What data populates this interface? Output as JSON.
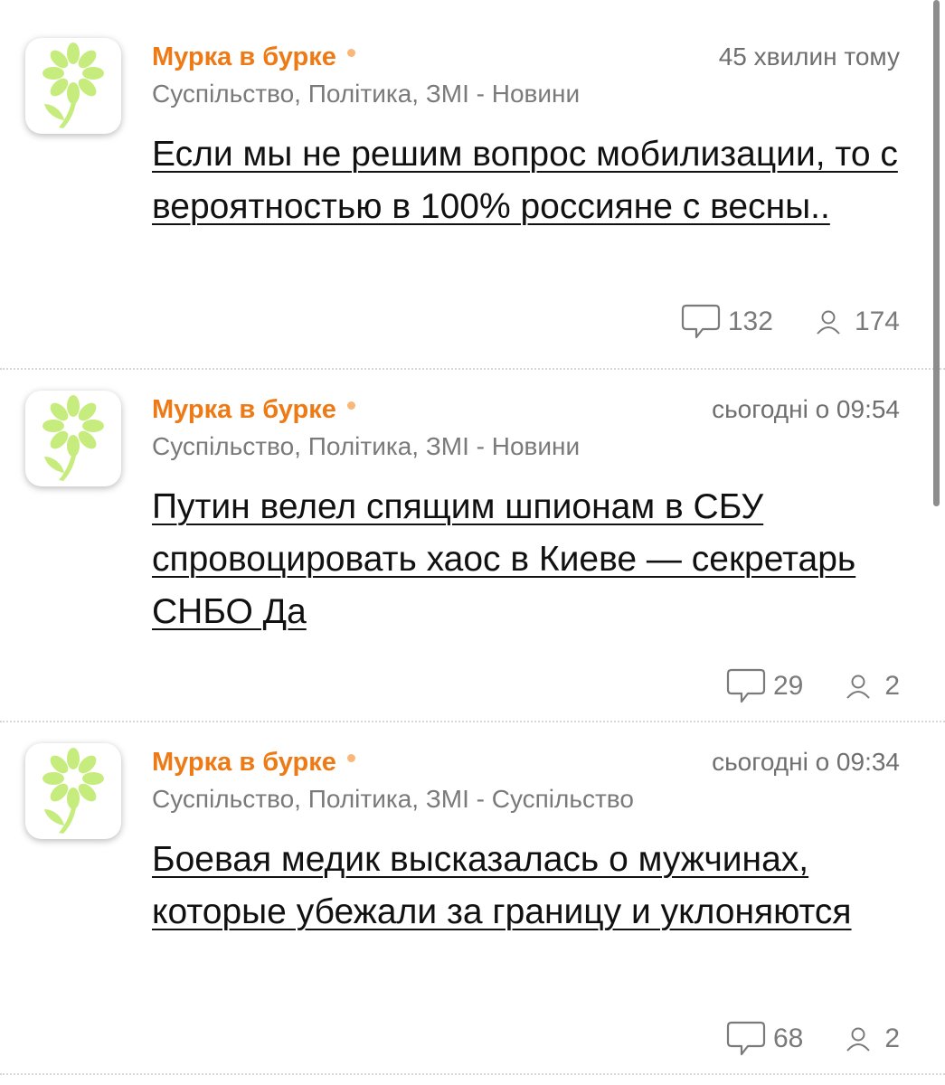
{
  "colors": {
    "author": "#ee7a16",
    "online_dot": "#f9b77a",
    "meta": "#7a7a7a",
    "title": "#111111",
    "flower": "#c6ec7e"
  },
  "icons": {
    "avatar": "flower-icon",
    "comments": "speech-bubble-icon",
    "readers": "person-icon"
  },
  "posts": [
    {
      "author": "Мурка в бурке",
      "time": "45 хвилин тому",
      "category": "Суспільство, Політика, ЗМІ - Новини",
      "title": "Если мы не решим вопрос мобилизации, то с вероятностью в 100% россияне с весны..",
      "comments": "132",
      "readers": "174"
    },
    {
      "author": "Мурка в бурке",
      "time": "сьогодні о 09:54",
      "category": "Суспільство, Політика, ЗМІ - Новини",
      "title": "Путин велел спящим шпионам в СБУ спровоцировать хаос в Киеве — секретарь СНБО Да",
      "comments": "29",
      "readers": "2"
    },
    {
      "author": "Мурка в бурке",
      "time": "сьогодні о 09:34",
      "category": "Суспільство, Політика, ЗМІ - Суспільство",
      "title": "Боевая медик высказалась о мужчинах, которые убежали за границу и уклоняются",
      "comments": "68",
      "readers": "2"
    }
  ]
}
